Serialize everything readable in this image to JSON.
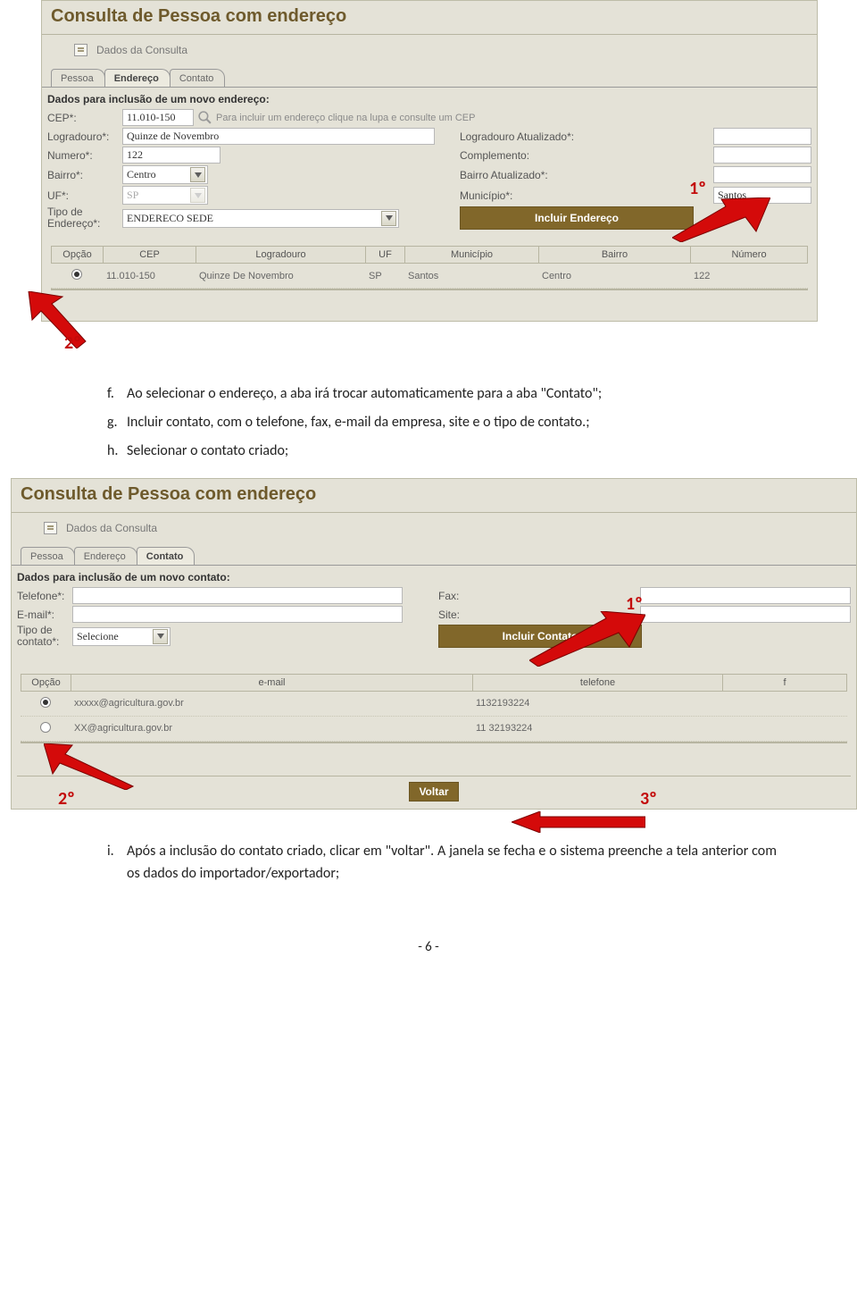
{
  "panel1": {
    "title": "Consulta de Pessoa com endereço",
    "section": "Dados da Consulta",
    "tabs": {
      "t1": "Pessoa",
      "t2": "Endereço",
      "t3": "Contato"
    },
    "heading": "Dados para inclusão de um novo endereço:",
    "labels": {
      "cep": "CEP*:",
      "log": "Logradouro*:",
      "num": "Numero*:",
      "bairro": "Bairro*:",
      "uf": "UF*:",
      "tipo": "Tipo de Endereço*:",
      "log_at": "Logradouro Atualizado*:",
      "comp": "Complemento:",
      "bairro_at": "Bairro Atualizado*:",
      "mun": "Município*:"
    },
    "values": {
      "cep": "11.010-150",
      "hint": "Para incluir um endereço clique na lupa e consulte um CEP",
      "log": "Quinze de Novembro",
      "num": "122",
      "bairro": "Centro",
      "uf": "SP",
      "tipo": "ENDERECO SEDE",
      "mun": "Santos"
    },
    "button": "Incluir Endereço",
    "grid": {
      "h": {
        "opcao": "Opção",
        "cep": "CEP",
        "log": "Logradouro",
        "uf": "UF",
        "mun": "Município",
        "bairro": "Bairro",
        "num": "Número"
      },
      "r1": {
        "cep": "11.010-150",
        "log": "Quinze De Novembro",
        "uf": "SP",
        "mun": "Santos",
        "bairro": "Centro",
        "num": "122"
      }
    }
  },
  "ann": {
    "a1": "1º",
    "a2": "2º",
    "a3": "3º"
  },
  "text1": {
    "f": {
      "mk": "f.",
      "tx": "Ao selecionar o endereço, a aba irá trocar automaticamente para a aba \"Contato\";"
    },
    "g": {
      "mk": "g.",
      "tx": "Incluir contato, com o telefone, fax, e-mail da empresa, site e o tipo de contato.;"
    },
    "h": {
      "mk": "h.",
      "tx": "Selecionar o contato criado;"
    }
  },
  "panel2": {
    "title": "Consulta de Pessoa com endereço",
    "section": "Dados da Consulta",
    "tabs": {
      "t1": "Pessoa",
      "t2": "Endereço",
      "t3": "Contato"
    },
    "heading": "Dados para inclusão de um novo contato:",
    "labels": {
      "tel": "Telefone*:",
      "email": "E-mail*:",
      "tipo": "Tipo de contato*:",
      "fax": "Fax:",
      "site": "Site:"
    },
    "values": {
      "tipo": "Selecione"
    },
    "button": "Incluir Contato",
    "grid": {
      "h": {
        "opcao": "Opção",
        "email": "e-mail",
        "tel": "telefone",
        "f": "f"
      },
      "r1": {
        "email": "xxxxx@agricultura.gov.br",
        "tel": "1132193224"
      },
      "r2": {
        "email": "XX@agricultura.gov.br",
        "tel": "11 32193224"
      }
    },
    "voltar": "Voltar"
  },
  "text2": {
    "i": {
      "mk": "i.",
      "tx": "Após a inclusão do contato criado, clicar em \"voltar\". A janela se fecha e o sistema preenche a tela anterior com os dados do importador/exportador;"
    }
  },
  "footer": "- 6 -"
}
